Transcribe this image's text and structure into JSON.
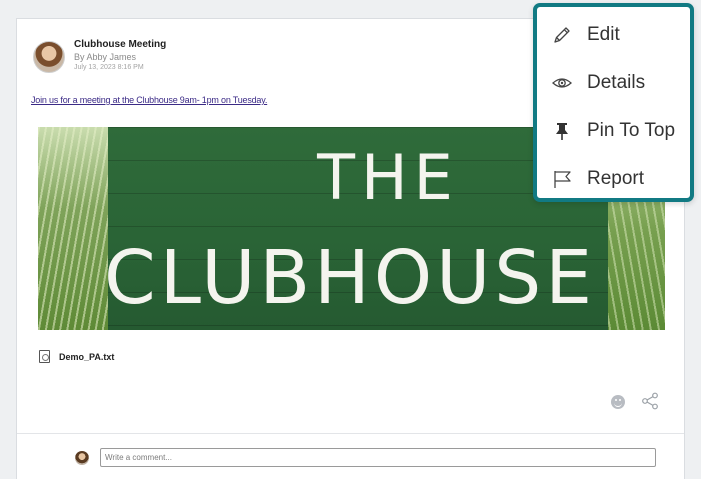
{
  "post": {
    "title": "Clubhouse Meeting",
    "author": "By Abby James",
    "date": "July 13, 2023 8:16 PM",
    "body": "Join us for a meeting at the Clubhouse 9am- 1pm on Tuesday.",
    "image": {
      "sign_line1": "THE",
      "sign_line2": "CLUBHOUSE"
    },
    "attachment": {
      "icon": "file-icon",
      "name": "Demo_PA.txt"
    },
    "actions": {
      "reaction_icon": "smiley-icon",
      "share_icon": "share-icon"
    }
  },
  "comment": {
    "placeholder": "Write a comment..."
  },
  "menu": {
    "accent": "#117a83",
    "items": [
      {
        "label": "Edit",
        "icon": "pencil-icon"
      },
      {
        "label": "Details",
        "icon": "eye-icon"
      },
      {
        "label": "Pin To Top",
        "icon": "pin-icon"
      },
      {
        "label": "Report",
        "icon": "flag-icon"
      }
    ]
  }
}
